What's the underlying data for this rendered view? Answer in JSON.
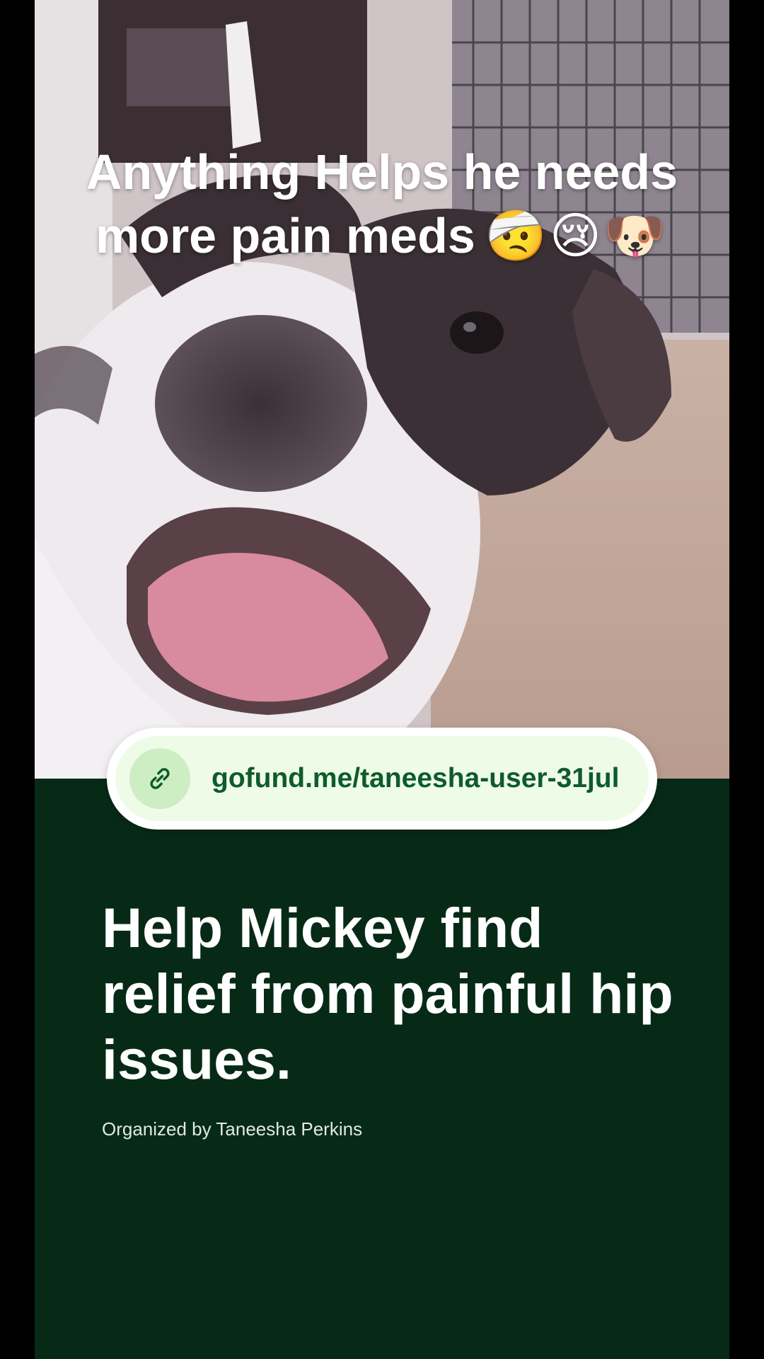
{
  "overlay": {
    "caption_line1": "Anything Helps he needs",
    "caption_line2": "more pain meds",
    "caption_emojis": "🤕😢🐶"
  },
  "link": {
    "icon": "link-icon",
    "url_text": "gofund.me/taneesha-user-31jul"
  },
  "campaign": {
    "title": "Help Mickey find relief from painful hip issues.",
    "organizer": "Organized by Taneesha Perkins"
  },
  "colors": {
    "panel_background": "#072a17",
    "link_text": "#0e5b2c",
    "link_pill_fill": "#eefbe7",
    "link_icon_circle": "#cdeec3",
    "title_text": "#ffffff"
  }
}
